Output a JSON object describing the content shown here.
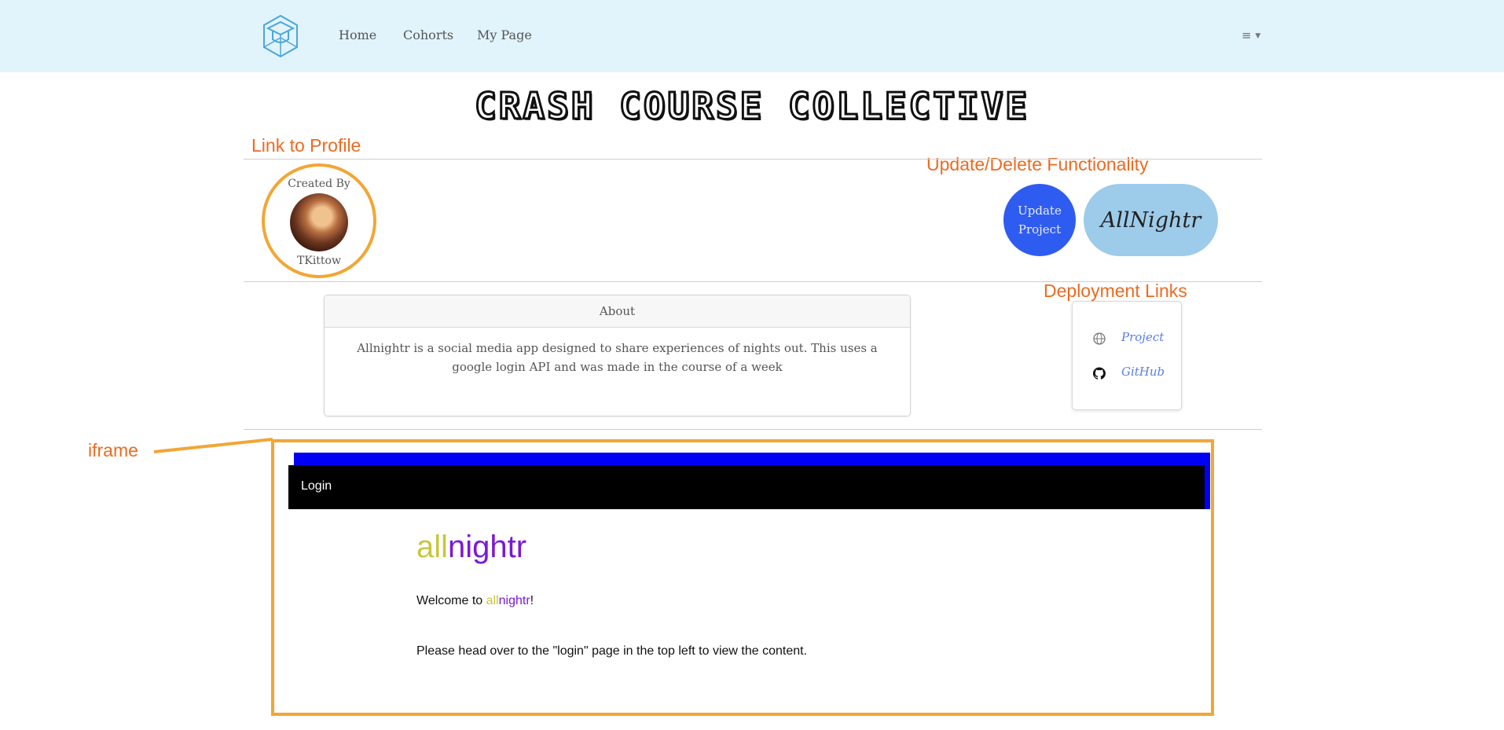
{
  "nav": {
    "links": [
      "Home",
      "Cohorts",
      "My Page"
    ],
    "menu_icon": "≡",
    "logo_icon": "graduation-cube-logo"
  },
  "site": {
    "title": "CRASH COURSE COLLECTIVE"
  },
  "annotations": {
    "profile": "Link to Profile",
    "update_delete": "Update/Delete Functionality",
    "deployment": "Deployment Links",
    "iframe": "iframe"
  },
  "creator": {
    "label": "Created By",
    "name": "TKittow"
  },
  "actions": {
    "update_label": "Update Project",
    "project_name": "AllNightr"
  },
  "about": {
    "header": "About",
    "body": "Allnightr is a social media app designed to share experiences of nights out. This uses a google login API and was made in the course of a week"
  },
  "deployment": {
    "links": [
      {
        "label": "Project",
        "icon": "globe-icon"
      },
      {
        "label": "GitHub",
        "icon": "github-icon"
      }
    ]
  },
  "iframe": {
    "nav_link": "Login",
    "brand_all": "all",
    "brand_rest": "nightr",
    "welcome_prefix": "Welcome to ",
    "welcome_suffix": "!",
    "instructions": "Please head over to the \"login\" page in the top left to view the content."
  },
  "colors": {
    "annotation": "#ec6b22",
    "highlight": "#f2a635",
    "navbar_bg": "#e1f3fb",
    "update_button": "#2f5cf0",
    "project_pill": "#9dcbea",
    "brand_all": "#c7c640",
    "brand_nightr": "#7b19d6",
    "iframe_header": "#0000f5"
  }
}
